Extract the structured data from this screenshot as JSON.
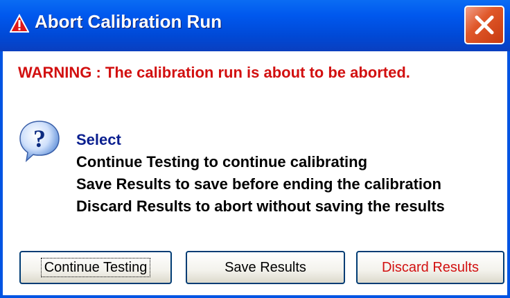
{
  "window": {
    "title": "Abort Calibration Run",
    "title_icon": "warning-triangle-icon",
    "close_icon": "close-icon"
  },
  "warning_text": "WARNING : The calibration run is about to be aborted.",
  "message": {
    "icon": "question-icon",
    "heading": "Select",
    "lines": [
      "Continue Testing to continue calibrating",
      "Save Results to save before ending the calibration",
      "Discard Results to abort without saving the results"
    ]
  },
  "buttons": {
    "continue_label": "Continue Testing",
    "save_label": "Save Results",
    "discard_label": "Discard Results"
  },
  "colors": {
    "titlebar": "#0058ee",
    "warning": "#d21010",
    "select_label": "#0a1f8f",
    "discard_text": "#d21010"
  }
}
